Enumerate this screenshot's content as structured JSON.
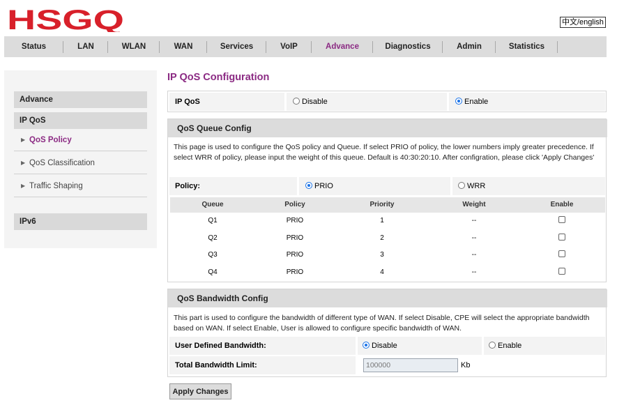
{
  "brand": {
    "logo_text": "HSGQ",
    "color": "#d8202a"
  },
  "lang_button": "中文/english",
  "nav": {
    "active_color": "#8b2a83",
    "tabs": [
      {
        "label": "Status"
      },
      {
        "label": "LAN"
      },
      {
        "label": "WLAN"
      },
      {
        "label": "WAN"
      },
      {
        "label": "Services"
      },
      {
        "label": "VoIP"
      },
      {
        "label": "Advance",
        "active": true
      },
      {
        "label": "Diagnostics"
      },
      {
        "label": "Admin"
      },
      {
        "label": "Statistics"
      }
    ]
  },
  "sidebar": {
    "section_advance": "Advance",
    "section_ipqos": "IP QoS",
    "items": [
      {
        "label": "QoS Policy",
        "active": true
      },
      {
        "label": "QoS Classification"
      },
      {
        "label": "Traffic Shaping"
      }
    ],
    "section_ipv6": "IPv6"
  },
  "page": {
    "title": "IP QoS Configuration",
    "ipqos": {
      "label": "IP QoS",
      "options": [
        "Disable",
        "Enable"
      ],
      "selected": "Enable"
    },
    "queue_config": {
      "heading": "QoS Queue Config",
      "description": "This page is used to configure the QoS policy and Queue. If select PRIO of policy, the lower numbers imply greater precedence. If select WRR of policy, please input the weight of this queue. Default is 40:30:20:10. After configration, please click 'Apply Changes'",
      "policy": {
        "label": "Policy:",
        "options": [
          "PRIO",
          "WRR"
        ],
        "selected": "PRIO"
      },
      "table": {
        "columns": [
          "Queue",
          "Policy",
          "Priority",
          "Weight",
          "Enable"
        ],
        "rows": [
          {
            "queue": "Q1",
            "policy": "PRIO",
            "priority": "1",
            "weight": "--",
            "enabled": false
          },
          {
            "queue": "Q2",
            "policy": "PRIO",
            "priority": "2",
            "weight": "--",
            "enabled": false
          },
          {
            "queue": "Q3",
            "policy": "PRIO",
            "priority": "3",
            "weight": "--",
            "enabled": false
          },
          {
            "queue": "Q4",
            "policy": "PRIO",
            "priority": "4",
            "weight": "--",
            "enabled": false
          }
        ]
      }
    },
    "bandwidth_config": {
      "heading": "QoS Bandwidth Config",
      "description": "This part is used to configure the bandwidth of different type of WAN. If select Disable, CPE will select the appropriate bandwidth based on WAN. If select Enable, User is allowed to configure specific bandwidth of WAN.",
      "user_defined": {
        "label": "User Defined Bandwidth:",
        "options": [
          "Disable",
          "Enable"
        ],
        "selected": "Disable"
      },
      "total_limit": {
        "label": "Total Bandwidth Limit:",
        "value": "100000",
        "unit": "Kb"
      }
    },
    "apply_button": "Apply Changes"
  }
}
